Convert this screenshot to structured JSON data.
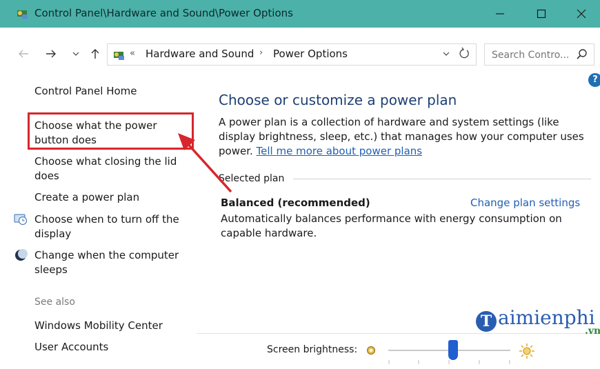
{
  "window": {
    "title": "Control Panel\\Hardware and Sound\\Power Options",
    "titlebar_color": "#4cb1a9"
  },
  "nav": {
    "back_icon": "arrow-left-icon",
    "forward_icon": "arrow-right-icon",
    "recent_icon": "chevron-down-icon",
    "up_icon": "arrow-up-icon",
    "breadcrumb_chevron": "«",
    "crumbs": [
      "Hardware and Sound",
      "Power Options"
    ],
    "separator": "›"
  },
  "search": {
    "placeholder": "Search Contro..."
  },
  "sidebar": {
    "home": "Control Panel Home",
    "items": [
      {
        "label": "Choose what the power button does"
      },
      {
        "label": "Choose what closing the lid does"
      },
      {
        "label": "Create a power plan"
      },
      {
        "label": "Choose when to turn off the display",
        "icon": "display-clock-icon"
      },
      {
        "label": "Change when the computer sleeps",
        "icon": "moon-icon"
      }
    ],
    "see_also": "See also",
    "see_also_items": [
      {
        "label": "Windows Mobility Center"
      },
      {
        "label": "User Accounts"
      }
    ]
  },
  "main": {
    "title": "Choose or customize a power plan",
    "description": "A power plan is a collection of hardware and system settings (like display brightness, sleep, etc.) that manages how your computer uses power. ",
    "description_link": "Tell me more about power plans",
    "selected_plan_label": "Selected plan",
    "plan_name": "Balanced (recommended)",
    "change_plan_link": "Change plan settings",
    "plan_description": "Automatically balances performance with energy consumption on capable hardware."
  },
  "brightness": {
    "label": "Screen brightness:",
    "level": 0.53
  },
  "watermark": {
    "text": "aimienphi",
    "initial": "T",
    "suffix": ".vn"
  },
  "colors": {
    "link": "#1f5fb5",
    "title": "#1e3f73",
    "highlight_box": "#d7262c",
    "slider_thumb": "#1f5fd0"
  }
}
